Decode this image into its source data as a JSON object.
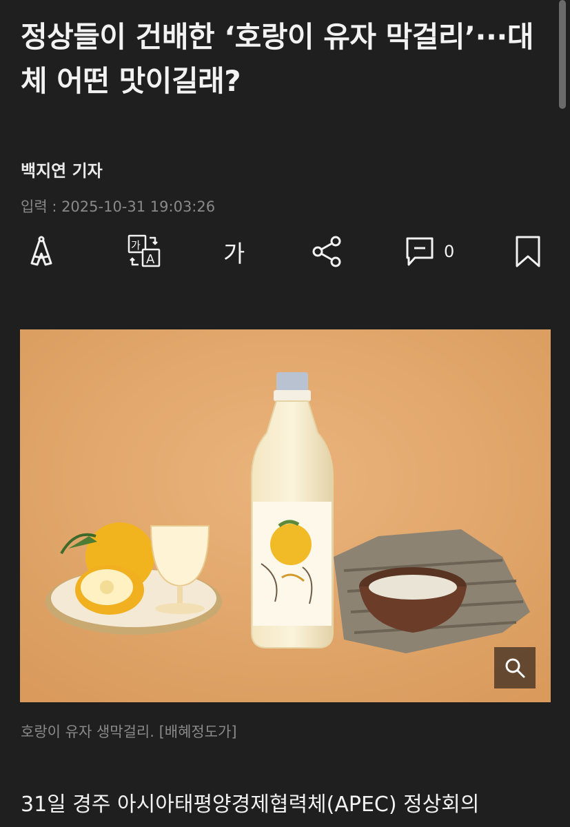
{
  "article": {
    "headline": "정상들이 건배한 ‘호랑이 유자 막걸리’···대체 어떤 맛이길래?",
    "reporter": "백지연 기자",
    "published": "입력 : 2025-10-31 19:03:26"
  },
  "toolbar": {
    "font_size_label": "가",
    "comment_count": "0",
    "icons": [
      "ai-summary-icon",
      "translate-icon",
      "font-size-icon",
      "share-icon",
      "comment-icon",
      "bookmark-icon"
    ]
  },
  "photo": {
    "caption": "호랑이 유자 생막걸리. [배혜정도가]",
    "zoom_icon": "magnifier-icon"
  },
  "body": {
    "first_line": "31일 경주 아시아태평양경제협력체(APEC) 정상회의"
  },
  "colors": {
    "background": "#1f1f1f",
    "text": "#f2f2f2",
    "muted": "#8a8a8a",
    "photo_background": "#e0a86f"
  }
}
